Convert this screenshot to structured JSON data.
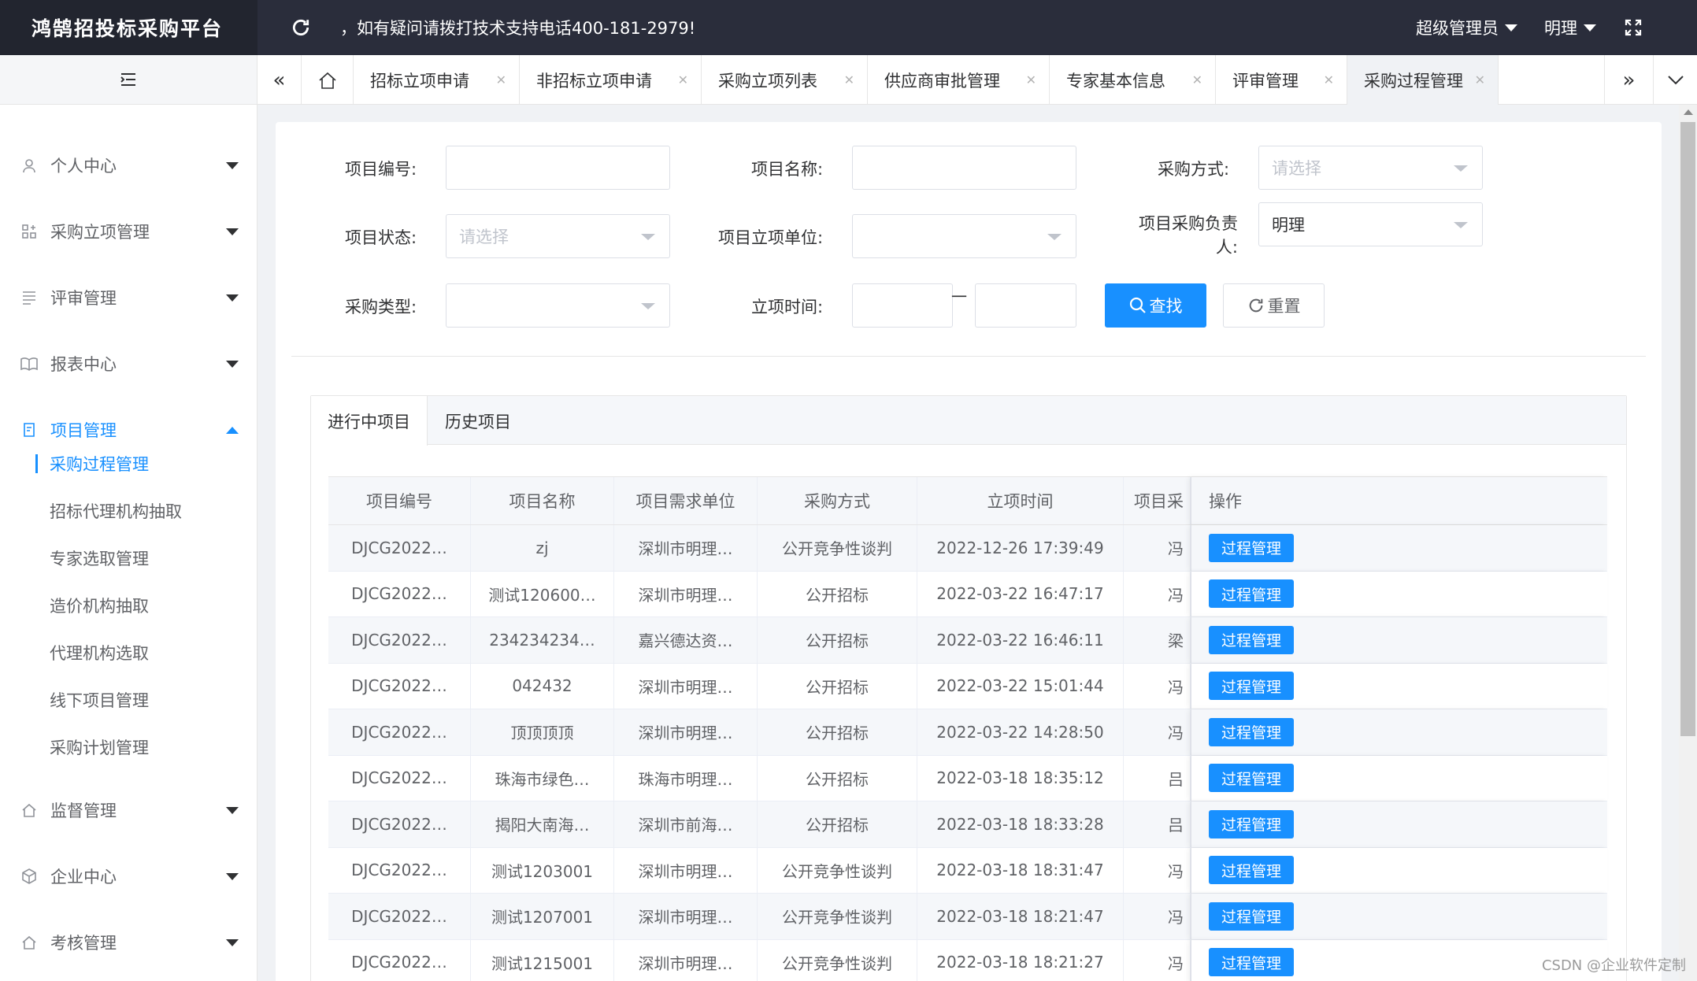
{
  "header": {
    "logo": "鸿鹄招投标采购平台",
    "notice": "，如有疑问请拨打技术支持电话400-181-2979!",
    "user_role": "超级管理员",
    "user_name": "明理"
  },
  "sidebar": {
    "items": [
      {
        "label": "个人中心",
        "icon": "user-icon"
      },
      {
        "label": "采购立项管理",
        "icon": "grid-icon"
      },
      {
        "label": "评审管理",
        "icon": "list-icon"
      },
      {
        "label": "报表中心",
        "icon": "book-icon"
      },
      {
        "label": "项目管理",
        "icon": "document-icon"
      },
      {
        "label": "监督管理",
        "icon": "home-icon"
      },
      {
        "label": "企业中心",
        "icon": "cube-icon"
      },
      {
        "label": "考核管理",
        "icon": "home-icon"
      }
    ],
    "sub_items": [
      "采购过程管理",
      "招标代理机构抽取",
      "专家选取管理",
      "造价机构抽取",
      "代理机构选取",
      "线下项目管理",
      "采购计划管理"
    ]
  },
  "tabs": [
    "招标立项申请",
    "非招标立项申请",
    "采购立项列表",
    "供应商审批管理",
    "专家基本信息",
    "评审管理",
    "采购过程管理"
  ],
  "form": {
    "project_no_label": "项目编号:",
    "project_name_label": "项目名称:",
    "purchase_method_label": "采购方式:",
    "purchase_method_placeholder": "请选择",
    "status_label": "项目状态:",
    "status_placeholder": "请选择",
    "unit_label": "项目立项单位:",
    "owner_label_1": "项目采购负责",
    "owner_label_2": "人:",
    "owner_value": "明理",
    "type_label": "采购类型:",
    "date_label": "立项时间:",
    "date_sep": "一",
    "search_btn": "查找",
    "reset_btn": "重置"
  },
  "panel_tabs": [
    "进行中项目",
    "历史项目"
  ],
  "table": {
    "headers": [
      "项目编号",
      "项目名称",
      "项目需求单位",
      "采购方式",
      "立项时间",
      "项目采",
      "操作"
    ],
    "op_label": "过程管理",
    "rows": [
      [
        "DJCG2022…",
        "zj",
        "深圳市明理…",
        "公开竞争性谈判",
        "2022-12-26 17:39:49",
        "冯"
      ],
      [
        "DJCG2022…",
        "测试120600…",
        "深圳市明理…",
        "公开招标",
        "2022-03-22 16:47:17",
        "冯"
      ],
      [
        "DJCG2022…",
        "234234234…",
        "嘉兴德达资…",
        "公开招标",
        "2022-03-22 16:46:11",
        "梁"
      ],
      [
        "DJCG2022…",
        "042432",
        "深圳市明理…",
        "公开招标",
        "2022-03-22 15:01:44",
        "冯"
      ],
      [
        "DJCG2022…",
        "顶顶顶顶",
        "深圳市明理…",
        "公开招标",
        "2022-03-22 14:28:50",
        "冯"
      ],
      [
        "DJCG2022…",
        "珠海市绿色…",
        "珠海市明理…",
        "公开招标",
        "2022-03-18 18:35:12",
        "吕"
      ],
      [
        "DJCG2022…",
        "揭阳大南海…",
        "深圳市前海…",
        "公开招标",
        "2022-03-18 18:33:28",
        "吕"
      ],
      [
        "DJCG2022…",
        "测试1203001",
        "深圳市明理…",
        "公开竞争性谈判",
        "2022-03-18 18:31:47",
        "冯"
      ],
      [
        "DJCG2022…",
        "测试1207001",
        "深圳市明理…",
        "公开竞争性谈判",
        "2022-03-18 18:21:47",
        "冯"
      ],
      [
        "DJCG2022…",
        "测试1215001",
        "深圳市明理…",
        "公开竞争性谈判",
        "2022-03-18 18:21:27",
        "冯"
      ]
    ]
  },
  "watermark": "CSDN @企业软件定制",
  "colors": {
    "accent": "#1890ff",
    "header_bg": "#2a2d3b"
  }
}
